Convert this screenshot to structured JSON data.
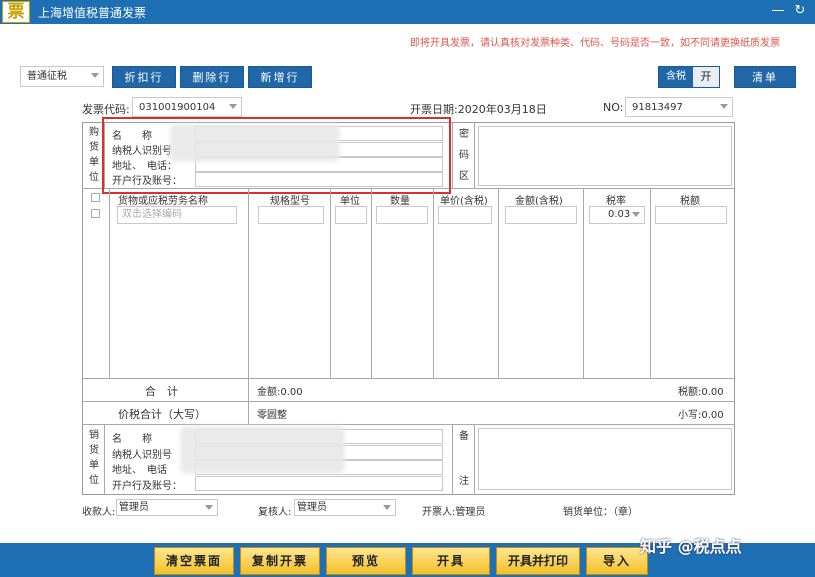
{
  "window": {
    "logo_char": "票",
    "title": "上海增值税普通发票",
    "min_glyph": "—",
    "back_glyph": "↻"
  },
  "notice": "即将开具发票，请认真核对发票种类、代码、号码是否一致，如不同请更换纸质发票",
  "toolbar": {
    "tax_type": "普通征税",
    "discount_label": "折扣行",
    "delete_label": "删除行",
    "add_label": "新增行",
    "tax_incl_label": "含税",
    "tax_incl_state": "开",
    "clear_label": "清单"
  },
  "invoice_meta": {
    "code_label": "发票代码:",
    "code_value": "031001900104",
    "date_text": "开票日期:2020年03月18日",
    "no_label": "NO:",
    "no_value": "91813497"
  },
  "buyer": {
    "side_chars": [
      "购",
      "货",
      "单",
      "位"
    ],
    "name_label": "名　　称",
    "taxid_label": "纳税人识别号",
    "addr_label": "地址、　电话：",
    "bank_label": "开户行及账号：",
    "cipher_chars": [
      "密",
      "码",
      "区"
    ]
  },
  "items": {
    "headers": [
      "货物或应税劳务名称",
      "规格型号",
      "单位",
      "数量",
      "单价(含税)",
      "金额(含税)",
      "税率",
      "税额"
    ],
    "name_placeholder": "双击选择编码",
    "tax_rate": "0.03"
  },
  "totals": {
    "sum_label": "合　计",
    "amount": "金额:0.00",
    "tax": "税额:0.00",
    "total_label": "价税合计（大写）",
    "total_upper": "零圆整",
    "total_lower": "小写:0.00"
  },
  "seller": {
    "side_chars": [
      "销",
      "货",
      "单",
      "位"
    ],
    "name_label": "名　　称",
    "taxid_label": "纳税人识别号",
    "addr_label": "地址、　电话",
    "bank_label": "开户行及账号：",
    "remark_chars": [
      "备",
      "注"
    ]
  },
  "signatures": {
    "payee_label": "收款人:",
    "payee_value": "管理员",
    "reviewer_label": "复核人:",
    "reviewer_value": "管理员",
    "drawer_text": "开票人:管理员",
    "seller_stamp": "销货单位：（章）"
  },
  "actions": {
    "clear_blank": "清空票面",
    "copy_issue": "复制开票",
    "preview": "预览",
    "issue": "开具",
    "issue_print": "开具并打印",
    "import": "导入"
  },
  "watermark": "知乎 @税点点"
}
